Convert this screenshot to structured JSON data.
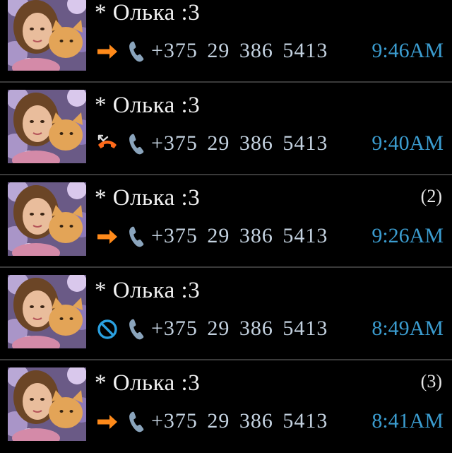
{
  "colors": {
    "background": "#000000",
    "name_text": "#f2f2f2",
    "number_text": "#c4d2e0",
    "time_text": "#3b9ccf",
    "outgoing_arrow": "#ff8a1a",
    "missed_icon": "#ff6a1a",
    "blocked_icon": "#2aa0e0",
    "phone_icon": "#8aa4bc",
    "divider": "#3a3a3a"
  },
  "calls": [
    {
      "name": "* Олька :3",
      "number": "+375 29 386 5413",
      "time": "9:46AM",
      "count": "",
      "type": "outgoing",
      "type_icon": "outgoing-arrow-icon"
    },
    {
      "name": "* Олька :3",
      "number": "+375 29 386 5413",
      "time": "9:40AM",
      "count": "",
      "type": "missed",
      "type_icon": "missed-call-icon"
    },
    {
      "name": "* Олька :3",
      "number": "+375 29 386 5413",
      "time": "9:26AM",
      "count": "(2)",
      "type": "outgoing",
      "type_icon": "outgoing-arrow-icon"
    },
    {
      "name": "* Олька :3",
      "number": "+375 29 386 5413",
      "time": "8:49AM",
      "count": "",
      "type": "blocked",
      "type_icon": "blocked-call-icon"
    },
    {
      "name": "* Олька :3",
      "number": "+375 29 386 5413",
      "time": "8:41AM",
      "count": "(3)",
      "type": "outgoing",
      "type_icon": "outgoing-arrow-icon"
    }
  ]
}
